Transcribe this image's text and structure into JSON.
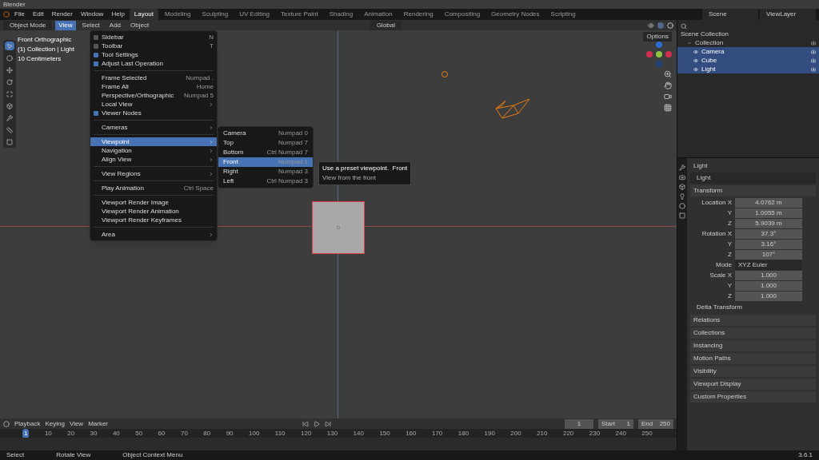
{
  "title_bar": {
    "title": "Blender"
  },
  "menus": [
    "File",
    "Edit",
    "Render",
    "Window",
    "Help"
  ],
  "workspaces": [
    {
      "label": "Layout",
      "selected": true
    },
    {
      "label": "Modeling",
      "selected": false
    },
    {
      "label": "Sculpting",
      "selected": false
    },
    {
      "label": "UV Editing",
      "selected": false
    },
    {
      "label": "Texture Paint",
      "selected": false
    },
    {
      "label": "Shading",
      "selected": false
    },
    {
      "label": "Animation",
      "selected": false
    },
    {
      "label": "Rendering",
      "selected": false
    },
    {
      "label": "Compositing",
      "selected": false
    },
    {
      "label": "Geometry Nodes",
      "selected": false
    },
    {
      "label": "Scripting",
      "selected": false
    }
  ],
  "scene": "Scene",
  "view_layer": "ViewLayer",
  "header": {
    "mode": "Object Mode",
    "menus": [
      {
        "label": "View",
        "selected": true
      },
      {
        "label": "Select",
        "selected": false
      },
      {
        "label": "Add",
        "selected": false
      },
      {
        "label": "Object",
        "selected": false
      }
    ],
    "orientation": "Global",
    "options": "Options"
  },
  "viewport": {
    "overlay_lines": [
      "Front Orthographic",
      "(1) Collection | Light",
      "10 Centimeters"
    ]
  },
  "view_menu": [
    {
      "kind": "check",
      "label": "Sidebar",
      "shortcut": "N",
      "checked": false,
      "selected": false
    },
    {
      "kind": "check",
      "label": "Toolbar",
      "shortcut": "T",
      "checked": false,
      "selected": false
    },
    {
      "kind": "check",
      "label": "Tool Settings",
      "checked": true,
      "selected": false
    },
    {
      "kind": "check",
      "label": "Adjust Last Operation",
      "checked": true,
      "selected": false
    },
    {
      "kind": "separator"
    },
    {
      "kind": "item",
      "label": "Frame Selected",
      "shortcut": "Numpad .",
      "selected": false
    },
    {
      "kind": "item",
      "label": "Frame All",
      "shortcut": "Home",
      "selected": false
    },
    {
      "kind": "item",
      "label": "Perspective/Orthographic",
      "shortcut": "Numpad 5",
      "selected": false
    },
    {
      "kind": "submenu",
      "label": "Local View",
      "selected": false
    },
    {
      "kind": "check",
      "label": "Viewer Nodes",
      "checked": true,
      "selected": false
    },
    {
      "kind": "separator"
    },
    {
      "kind": "submenu",
      "label": "Cameras",
      "selected": false
    },
    {
      "kind": "separator"
    },
    {
      "kind": "submenu",
      "label": "Viewpoint",
      "selected": true
    },
    {
      "kind": "submenu",
      "label": "Navigation",
      "selected": false
    },
    {
      "kind": "submenu",
      "label": "Align View",
      "selected": false
    },
    {
      "kind": "separator"
    },
    {
      "kind": "submenu",
      "label": "View Regions",
      "selected": false
    },
    {
      "kind": "separator"
    },
    {
      "kind": "item",
      "label": "Play Animation",
      "shortcut": "Ctrl Space",
      "selected": false
    },
    {
      "kind": "separator"
    },
    {
      "kind": "item",
      "label": "Viewport Render Image",
      "selected": false
    },
    {
      "kind": "item",
      "label": "Viewport Render Animation",
      "selected": false
    },
    {
      "kind": "item",
      "label": "Viewport Render Keyframes",
      "selected": false
    },
    {
      "kind": "separator"
    },
    {
      "kind": "submenu",
      "label": "Area",
      "selected": false
    }
  ],
  "viewpoint_menu": [
    {
      "label": "Camera",
      "shortcut": "Numpad 0",
      "selected": false
    },
    {
      "label": "Top",
      "shortcut": "Numpad 7",
      "selected": false
    },
    {
      "label": "Bottom",
      "shortcut": "Ctrl Numpad 7",
      "selected": false
    },
    {
      "label": "Front",
      "shortcut": "Numpad 1",
      "selected": true
    },
    {
      "label": "Right",
      "shortcut": "Numpad 3",
      "selected": false
    },
    {
      "label": "Left",
      "shortcut": "Ctrl Numpad 3",
      "selected": false
    }
  ],
  "tooltip": {
    "text": "Use a preset viewpoint.  Front",
    "detail": "View from the front"
  },
  "outliner": {
    "root": "Scene Collection",
    "children": [
      {
        "label": "Collection",
        "selected": false,
        "children": [
          {
            "label": "Camera",
            "selected": true
          },
          {
            "label": "Cube",
            "selected": true
          },
          {
            "label": "Light",
            "selected": true
          }
        ]
      }
    ]
  },
  "properties": {
    "object": "Light",
    "data": "Light",
    "section": "Transform",
    "fields": [
      {
        "label": "Location X",
        "value": "4.0762 m"
      },
      {
        "label": "Y",
        "value": "1.0055 m"
      },
      {
        "label": "Z",
        "value": "5.9039 m"
      },
      {
        "label": "Rotation X",
        "value": "37.3°"
      },
      {
        "label": "Y",
        "value": "3.16°"
      },
      {
        "label": "Z",
        "value": "107°"
      },
      {
        "label": "Mode",
        "value": "XYZ Euler",
        "kind": "dropdown"
      },
      {
        "label": "Scale X",
        "value": "1.000"
      },
      {
        "label": "Y",
        "value": "1.000"
      },
      {
        "label": "Z",
        "value": "1.000"
      }
    ],
    "subsection": "Delta Transform",
    "panels": [
      "Relations",
      "Collections",
      "Instancing",
      "Motion Paths",
      "Visibility",
      "Viewport Display",
      "Custom Properties"
    ]
  },
  "timeline": {
    "menus": [
      "Playback",
      "Keying",
      "View",
      "Marker"
    ],
    "current_frame": "1",
    "start_label": "Start",
    "start": "1",
    "end_label": "End",
    "end": "250",
    "ticks": [
      "1",
      "10",
      "20",
      "30",
      "40",
      "50",
      "60",
      "70",
      "80",
      "90",
      "100",
      "110",
      "120",
      "130",
      "140",
      "150",
      "160",
      "170",
      "180",
      "190",
      "200",
      "210",
      "220",
      "230",
      "240",
      "250"
    ]
  },
  "status_bar": {
    "items": [
      "Select",
      "Rotate View",
      "Object Context Menu"
    ],
    "version": "3.6.1"
  }
}
